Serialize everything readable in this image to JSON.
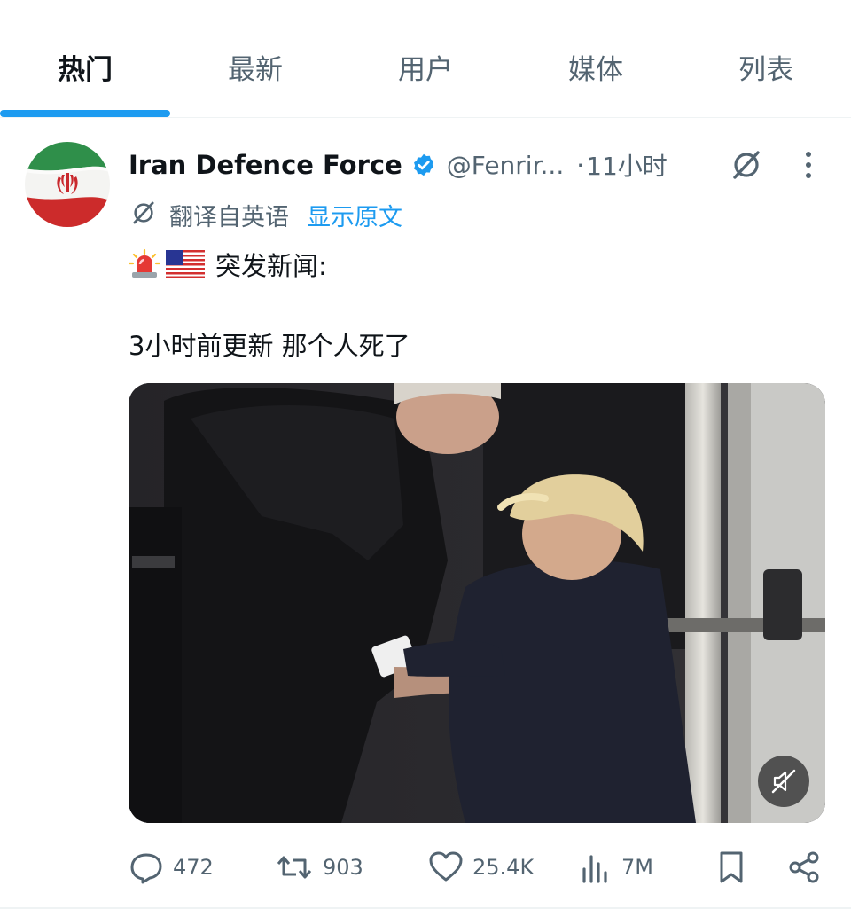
{
  "tabs": [
    {
      "label": "热门",
      "active": true
    },
    {
      "label": "最新",
      "active": false
    },
    {
      "label": "用户",
      "active": false
    },
    {
      "label": "媒体",
      "active": false
    },
    {
      "label": "列表",
      "active": false
    }
  ],
  "tweet": {
    "display_name": "Iran Defence Force",
    "handle": "@Fenrir...",
    "dot": "·",
    "time": "11小时",
    "translate_label": "翻译自英语",
    "show_original": "显示原文",
    "line1_emojis": [
      "police-light-emoji",
      "us-flag-emoji"
    ],
    "line1_text": "突发新闻:",
    "line2_text": "3小时前更新 那个人死了"
  },
  "actions": {
    "replies": "472",
    "reposts": "903",
    "likes": "25.4K",
    "views": "7M"
  },
  "icons": {
    "verified": "verified-badge-icon",
    "grok": "grok-icon",
    "more": "more-icon",
    "translate": "translate-icon",
    "mute": "muted-speaker-icon",
    "reply": "reply-icon",
    "repost": "repost-icon",
    "like": "heart-icon",
    "views": "views-icon",
    "bookmark": "bookmark-icon",
    "share": "share-icon"
  },
  "colors": {
    "accent": "#1d9bf0",
    "text_primary": "#0f1419",
    "text_secondary": "#536471"
  }
}
